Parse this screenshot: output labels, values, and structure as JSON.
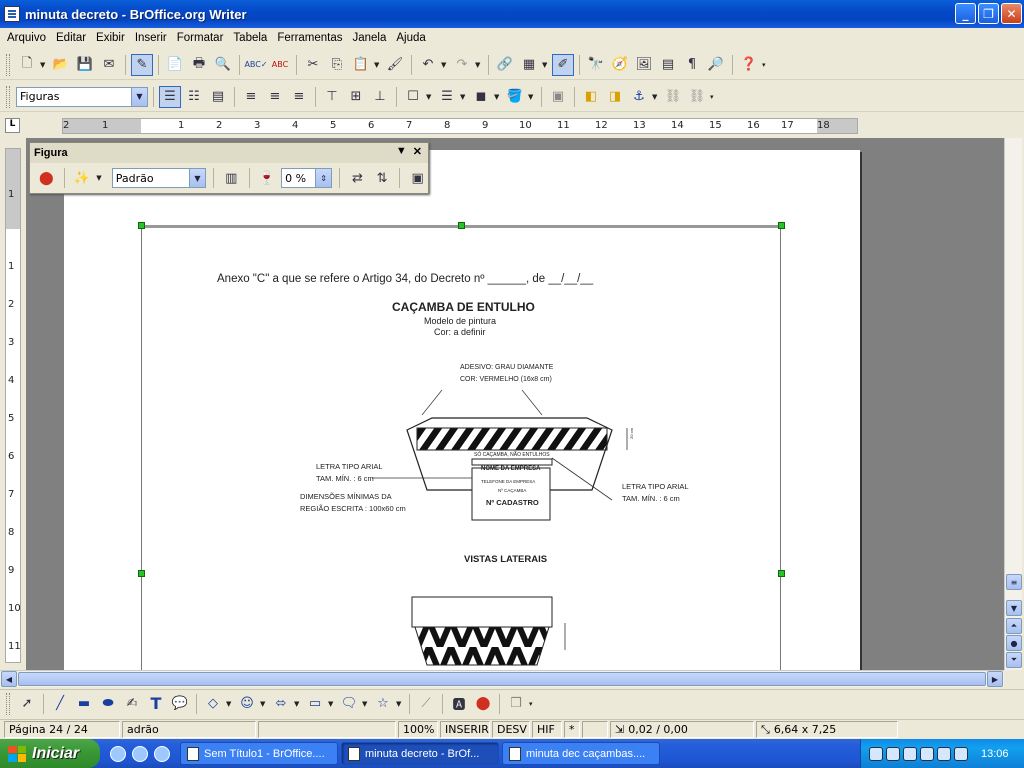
{
  "window": {
    "title": "minuta decreto - BrOffice.org Writer"
  },
  "menu": [
    "Arquivo",
    "Editar",
    "Exibir",
    "Inserir",
    "Formatar",
    "Tabela",
    "Ferramentas",
    "Janela",
    "Ajuda"
  ],
  "format_toolbar": {
    "style_value": "Figuras"
  },
  "ruler_h": [
    "2",
    "1",
    "1",
    "2",
    "3",
    "4",
    "5",
    "6",
    "7",
    "8",
    "9",
    "10",
    "11",
    "12",
    "13",
    "14",
    "15",
    "16",
    "17",
    "18"
  ],
  "ruler_v": [
    "1",
    "1",
    "2",
    "3",
    "4",
    "5",
    "6",
    "7",
    "8",
    "9",
    "10",
    "11"
  ],
  "figura_toolbar": {
    "title": "Figura",
    "mode_value": "Padrão",
    "transparency_value": "0 %"
  },
  "document": {
    "heading": "Anexo \"C\" a que se refere o Artigo 34, do Decreto nº ______, de __/__/__",
    "title": "CAÇAMBA DE ENTULHO",
    "subtitle1": "Modelo de pintura",
    "subtitle2": "Cor: a definir",
    "adhesive_line1": "ADESIVO: GRAU DIAMANTE",
    "adhesive_line2": "COR: VERMELHO (16x8 cm)",
    "letter_left_1": "LETRA TIPO ARIAL",
    "letter_left_2": "TAM. MÍN. : 6 cm",
    "dim_1": "DIMENSÕES MÍNIMAS DA",
    "dim_2": "REGIÃO ESCRITA : 100x60 cm",
    "letter_right_1": "LETRA TIPO ARIAL",
    "letter_right_2": "TAM. MÍN. : 6 cm",
    "plate_top": "SÓ CAÇAMBA, NÃO ENTULHOS",
    "plate_line1": "NOME DA EMPRESA",
    "plate_line2": "TELEFONE DA EMPRESA",
    "plate_line3": "Nº CAÇAMBA",
    "plate_line4": "Nº CADASTRO",
    "dim_side": "20 cm",
    "side_views": "VISTAS LATERAIS"
  },
  "status": {
    "page": "Página 24 / 24",
    "style": "adrão",
    "zoom": "100%",
    "insert": "INSERIR",
    "select": "DESV",
    "hyph": "HIF",
    "star": "*",
    "position": "0,02 / 0,00",
    "size": "6,64 x 7,25"
  },
  "taskbar": {
    "start": "Iniciar",
    "items": [
      "Sem Título1 - BrOffice....",
      "minuta decreto - BrOf...",
      "minuta dec caçambas...."
    ],
    "clock": "13:06"
  }
}
